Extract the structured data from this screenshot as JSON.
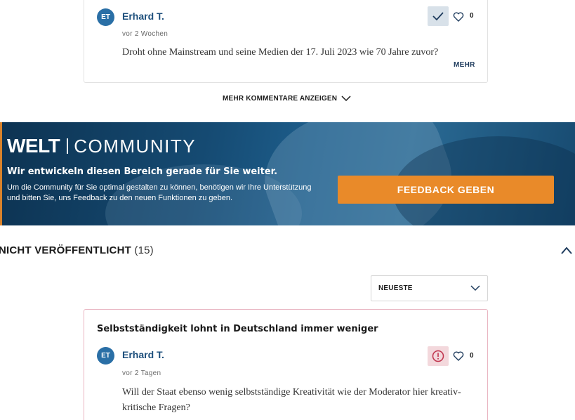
{
  "top_comment": {
    "avatar_initials": "ET",
    "author": "Erhard T.",
    "time": "vor 2 Wochen",
    "text": "Droht ohne Mainstream und seine Medien der 17. Juli 2023 wie 70 Jahre zuvor?",
    "likes": "0",
    "more_label": "MEHR",
    "status_icon": "check-icon"
  },
  "show_more_label": "MEHR KOMMENTARE ANZEIGEN",
  "banner": {
    "brand_welt": "WELT",
    "brand_community": "COMMUNITY",
    "headline": "Wir entwickeln diesen Bereich gerade für Sie weiter.",
    "text": "Um die Community für Sie optimal gestalten zu können, benötigen wir Ihre Unterstützung und bitten Sie, uns Feedback zu den neuen Funktionen zu geben.",
    "button_label": "FEEDBACK GEBEN",
    "accent_color": "#e98a29"
  },
  "section": {
    "label": "NICHT VERÖFFENTLICHT",
    "count": "(15)"
  },
  "sort": {
    "selected": "NEUESTE"
  },
  "bottom_comment": {
    "article_title": "Selbstständigkeit lohnt in Deutschland immer weniger",
    "avatar_initials": "ET",
    "author": "Erhard T.",
    "time": "vor 2 Tagen",
    "text_line1": "Will der Staat ebenso wenig selbstständige Kreativität wie der Moderator hier kreativ-",
    "text_line2": "kritische Fragen?",
    "likes": "0",
    "status_icon": "warning-icon"
  }
}
